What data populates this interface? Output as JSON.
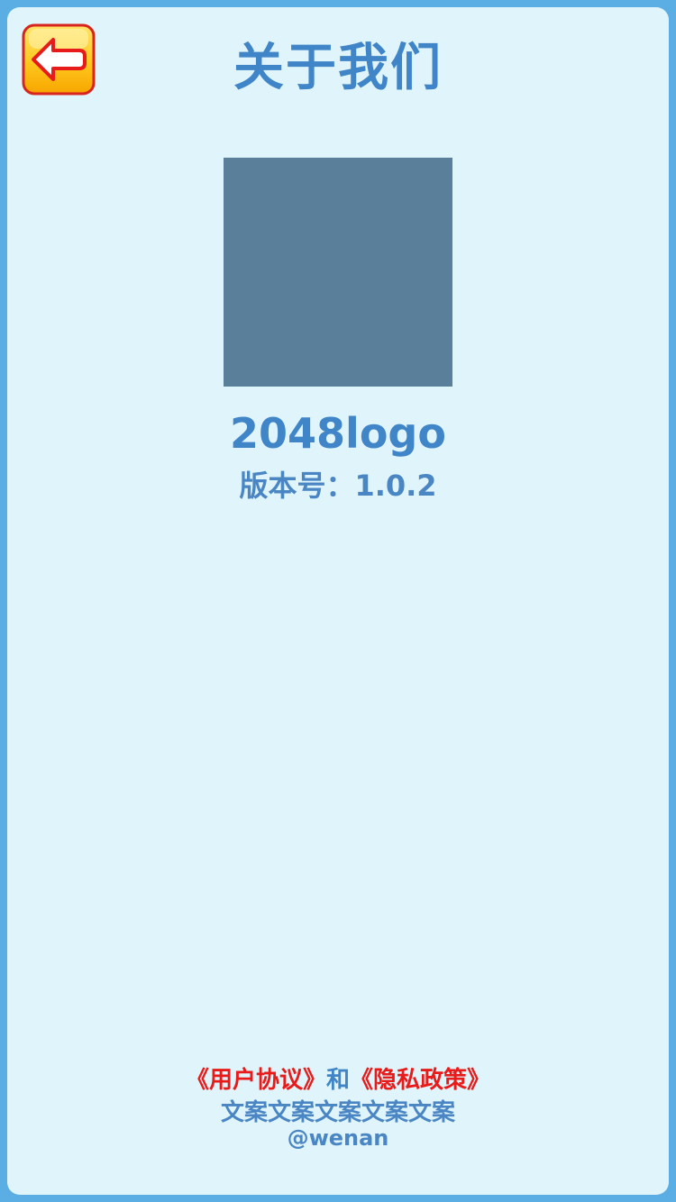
{
  "header": {
    "title": "关于我们",
    "back_icon": "back-arrow-icon"
  },
  "app": {
    "logo_placeholder_color": "#5a7f9b",
    "name": "2048logo",
    "version_label": "版本号：",
    "version": "1.0.2"
  },
  "footer": {
    "user_agreement": "《用户协议》",
    "joiner": "和",
    "privacy_policy": "《隐私政策》",
    "copy": "文案文案文案文案文案",
    "handle": "@wenan"
  },
  "colors": {
    "frame": "#5aaee3",
    "background": "#e0f5fb",
    "text_blue": "#3f85c8",
    "link_red": "#e81b1b",
    "button_yellow": "#ffc81e"
  }
}
